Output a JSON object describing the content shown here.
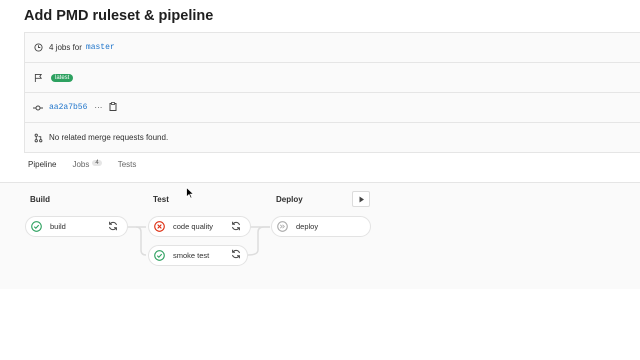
{
  "page": {
    "title": "Add PMD ruleset & pipeline"
  },
  "info": {
    "jobs_prefix": "4 jobs for",
    "branch": "master",
    "badge": "latest",
    "commit": "aa2a7b56",
    "commit_more": "···",
    "merge_text": "No related merge requests found."
  },
  "tabs": [
    {
      "label": "Pipeline",
      "active": true
    },
    {
      "label": "Jobs",
      "count": "4"
    },
    {
      "label": "Tests"
    }
  ],
  "stages": [
    {
      "name": "Build",
      "jobs": [
        {
          "name": "build",
          "status": "success"
        }
      ]
    },
    {
      "name": "Test",
      "jobs": [
        {
          "name": "code quality",
          "status": "failed"
        },
        {
          "name": "smoke test",
          "status": "success"
        }
      ]
    },
    {
      "name": "Deploy",
      "jobs": [
        {
          "name": "deploy",
          "status": "skipped"
        }
      ]
    }
  ],
  "colors": {
    "success": "#2da160",
    "failed": "#dd2b0e",
    "link": "#1f75cb",
    "skipped": "#aaaaaa"
  }
}
